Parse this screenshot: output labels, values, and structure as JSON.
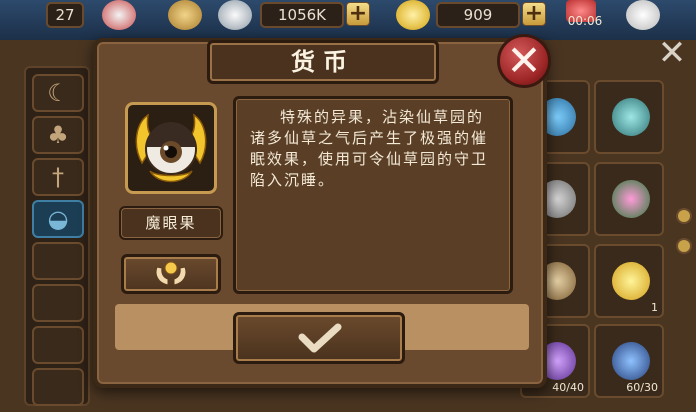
{
  "hud": {
    "level": "27",
    "silver": "1056K",
    "gold": "909",
    "plus": "+",
    "timer": "00:06"
  },
  "dialog": {
    "title": "货币",
    "close_icon": "close-x-icon",
    "item_name": "魔眼果",
    "description": "特殊的异果，沾染仙草园的诸多仙草之气后产生了极强的催眠效果，使用可令仙草园的守卫陷入沉睡。",
    "use_icon": "hands-holding-orb-icon",
    "confirm_icon": "checkmark-icon"
  },
  "background": {
    "close": "✕",
    "category_tabs": [
      "horn-icon",
      "plant-icon",
      "dagger-icon",
      "ingot-icon",
      "empty",
      "empty",
      "empty",
      "empty"
    ],
    "active_tab": 3,
    "grid_counts": [
      "",
      "",
      "1",
      "",
      "40/40",
      "60/30"
    ]
  },
  "colors": {
    "panel": "#6a4a2e",
    "frame_gold": "#c79a52",
    "close_red": "#b33434"
  }
}
